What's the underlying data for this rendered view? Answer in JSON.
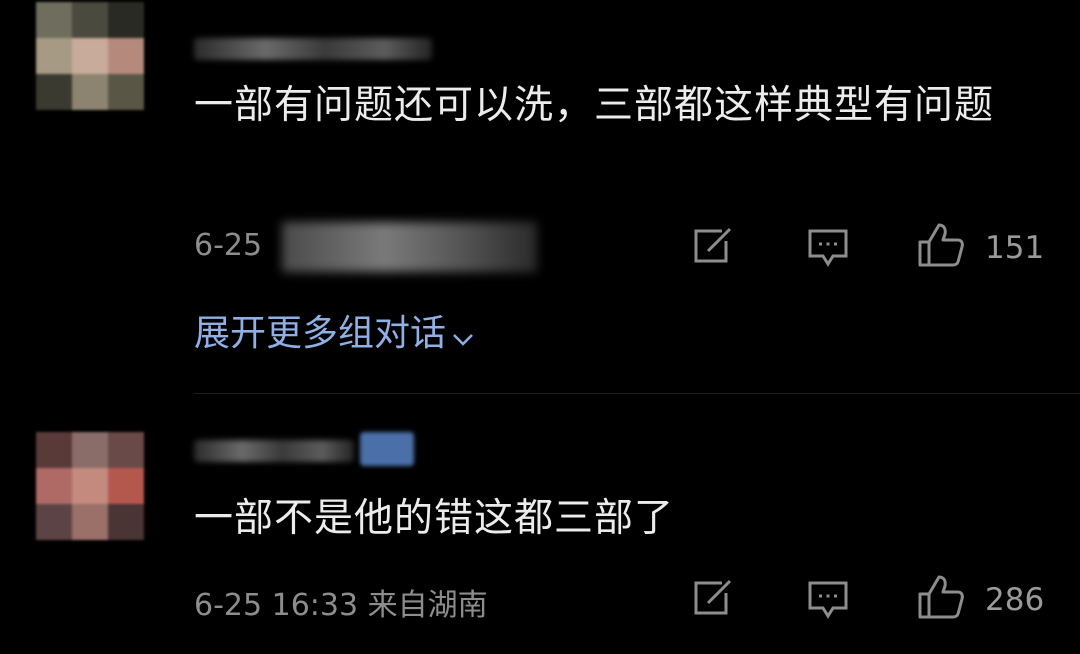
{
  "comments": [
    {
      "text": "一部有问题还可以洗，三部都这样典型有问题",
      "date": "6-25",
      "likes": "151"
    },
    {
      "text": "一部不是他的错这都三部了",
      "date": "6-25 16:33",
      "location": "来自湖南",
      "likes": "286"
    }
  ],
  "expand_replies": "展开更多组对话",
  "icons": [
    "share-icon",
    "comment-icon",
    "thumbs-up-icon",
    "chevron-down-icon"
  ],
  "colors": {
    "background": "#000000",
    "text": "#ececec",
    "meta": "#8d8d8d",
    "link": "#8fb0e6"
  }
}
